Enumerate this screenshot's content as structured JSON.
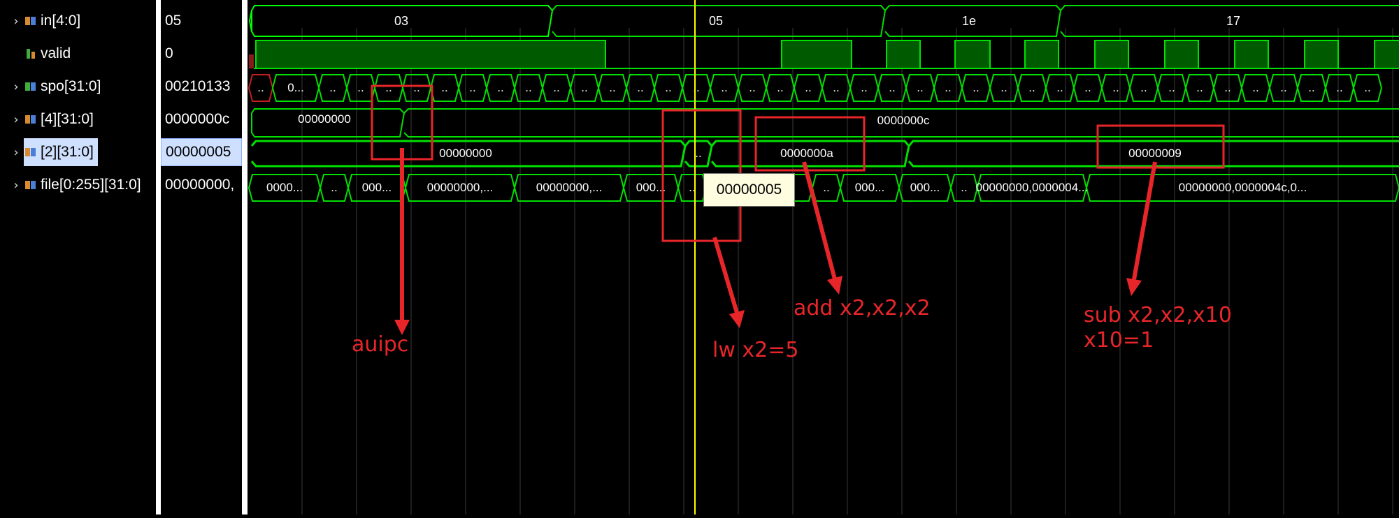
{
  "signals": [
    {
      "name": "in[4:0]",
      "value": "05",
      "expandable": true,
      "icon": "bus-signal-icon"
    },
    {
      "name": "valid",
      "value": "0",
      "expandable": false,
      "icon": "bit-signal-icon"
    },
    {
      "name": "spo[31:0]",
      "value": "00210133",
      "expandable": true,
      "icon": "bus-signal-icon"
    },
    {
      "name": "[4][31:0]",
      "value": "0000000c",
      "expandable": true,
      "icon": "bus-signal-icon"
    },
    {
      "name": "[2][31:0]",
      "value": "00000005",
      "expandable": true,
      "icon": "bus-signal-icon",
      "selected": true
    },
    {
      "name": "file[0:255][31:0]",
      "value": "00000000,",
      "expandable": true,
      "icon": "bus-signal-icon"
    }
  ],
  "waveform": {
    "in_labels": [
      "03",
      "05",
      "1e",
      "17"
    ],
    "reg4_labels": [
      "00000000",
      "0000000c"
    ],
    "reg2_labels": [
      "00000000",
      "..",
      "0000000a",
      "00000009"
    ],
    "spo_labels": [
      "..",
      "0..."
    ],
    "spo_short": "..",
    "file_labels": [
      "0000...",
      "..",
      "000...",
      "00000000,...",
      "00000000,...",
      "000...",
      "..",
      "000...",
      "..",
      "000...",
      "000...",
      "..",
      "00000000,0000004...",
      "00000000,0000004c,0..."
    ]
  },
  "tooltip": "00000005",
  "annotations": {
    "auipc": "auipc",
    "lw": "lw  x2=5",
    "add": "add x2,x2,x2",
    "sub_line1": "sub x2,x2,x10",
    "sub_line2": "x10=1"
  },
  "colors": {
    "wave": "#00e000",
    "valid_fill": "#005a00",
    "cursor": "#ffff00",
    "annotation": "#e8262a",
    "grid": "#3a3a3a"
  }
}
